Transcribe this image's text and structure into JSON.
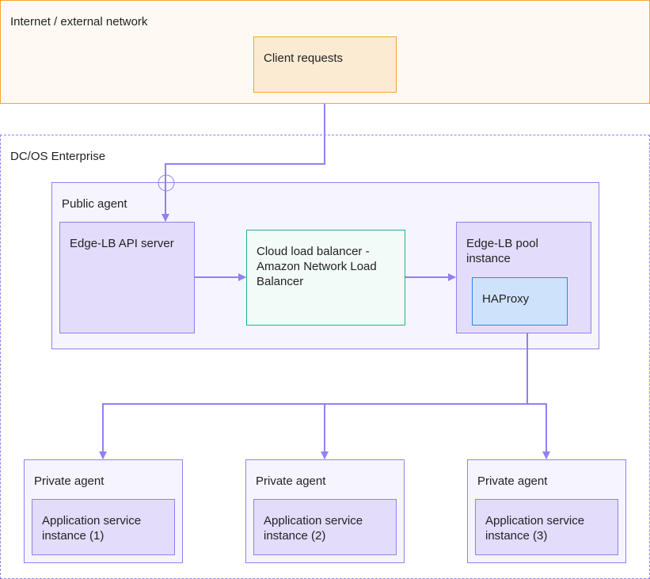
{
  "diagram": {
    "zones": {
      "internet": "Internet / external network",
      "dcos": "DC/OS Enterprise"
    },
    "nodes": {
      "client": "Client requests",
      "public_agent": "Public agent",
      "api_server": "Edge-LB API server",
      "cloud_lb": "Cloud load balancer -\nAmazon Network Load\nBalancer",
      "pool": "Edge-LB pool\ninstance",
      "haproxy": "HAProxy",
      "private_agents": [
        {
          "label": "Private agent",
          "app": "Application service\ninstance (1)"
        },
        {
          "label": "Private agent",
          "app": "Application service\ninstance (2)"
        },
        {
          "label": "Private agent",
          "app": "Application service\ninstance (3)"
        }
      ]
    },
    "edges": [
      {
        "from": "Client requests",
        "to": "Edge-LB API server"
      },
      {
        "from": "Edge-LB API server",
        "to": "Cloud load balancer"
      },
      {
        "from": "Cloud load balancer",
        "to": "Edge-LB pool instance"
      },
      {
        "from": "Edge-LB pool instance",
        "to": "Application service instance (1)"
      },
      {
        "from": "Edge-LB pool instance",
        "to": "Application service instance (2)"
      },
      {
        "from": "Edge-LB pool instance",
        "to": "Application service instance (3)"
      }
    ],
    "colors": {
      "internet_border": "#f4a532",
      "agent_border": "#9380f0",
      "cloud_lb_border": "#1fb58a",
      "haproxy_border": "#2f86e8",
      "connector": "#9380f0"
    }
  }
}
